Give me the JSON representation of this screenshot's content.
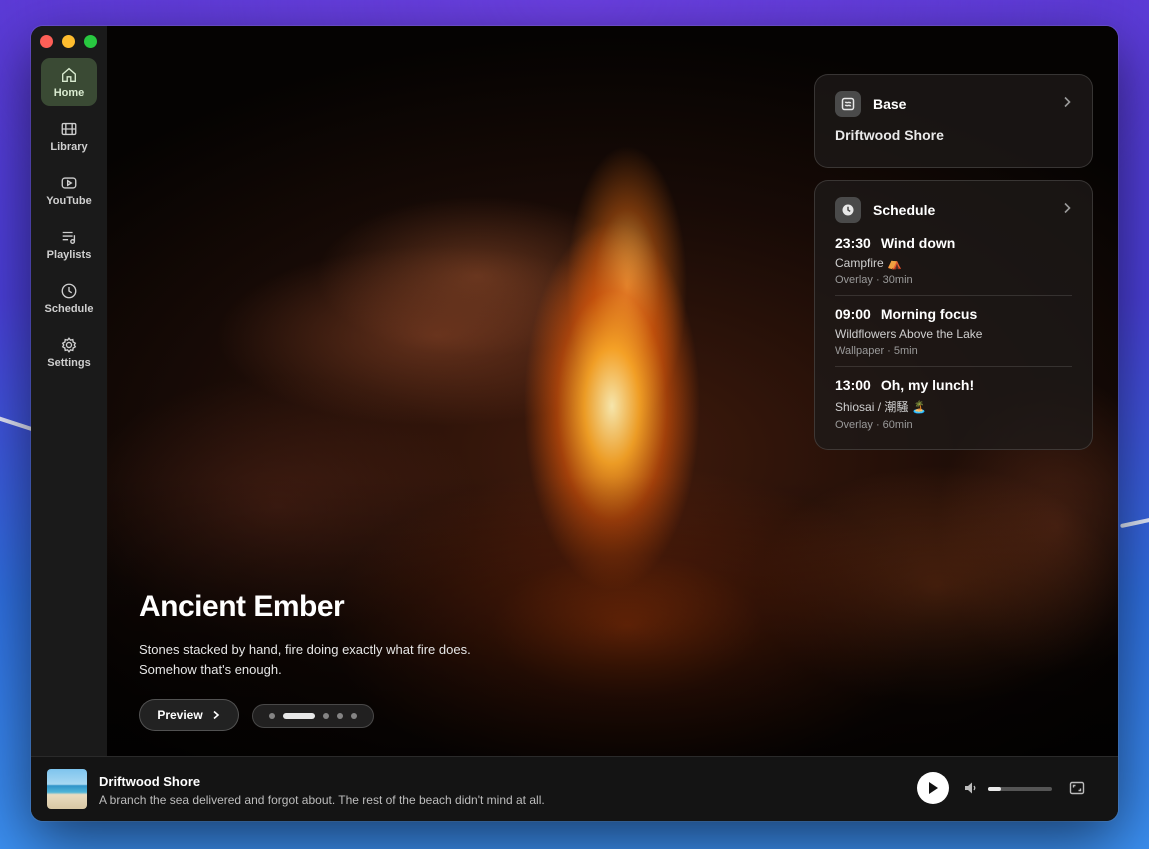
{
  "sidebar": {
    "items": [
      {
        "label": "Home",
        "icon": "home-icon",
        "active": true
      },
      {
        "label": "Library",
        "icon": "film-icon"
      },
      {
        "label": "YouTube",
        "icon": "play-box-icon"
      },
      {
        "label": "Playlists",
        "icon": "playlist-icon"
      },
      {
        "label": "Schedule",
        "icon": "clock-icon"
      },
      {
        "label": "Settings",
        "icon": "gear-icon"
      }
    ]
  },
  "hero": {
    "title": "Ancient Ember",
    "description_line1": "Stones stacked by hand, fire doing exactly what fire does.",
    "description_line2": "Somehow that's enough.",
    "preview_label": "Preview",
    "carousel": {
      "count": 5,
      "active_index": 1
    }
  },
  "base_card": {
    "title": "Base",
    "value": "Driftwood Shore"
  },
  "schedule_card": {
    "title": "Schedule",
    "items": [
      {
        "time": "23:30",
        "name": "Wind down",
        "scene": "Campfire ⛺",
        "meta": "Overlay · 30min"
      },
      {
        "time": "09:00",
        "name": "Morning focus",
        "scene": "Wildflowers Above the Lake",
        "meta": "Wallpaper · 5min"
      },
      {
        "time": "13:00",
        "name": "Oh, my lunch!",
        "scene": "Shiosai / 潮騒 🏝️",
        "meta": "Overlay · 60min"
      }
    ]
  },
  "now_playing": {
    "title": "Driftwood Shore",
    "subtitle": "A branch the sea delivered and forgot about. The rest of the beach didn't mind at all.",
    "volume_percent": 20
  },
  "colors": {
    "accent_active": "#3a4a34",
    "traffic_close": "#fe5f57",
    "traffic_minimize": "#febc2e",
    "traffic_maximize": "#28c840"
  }
}
